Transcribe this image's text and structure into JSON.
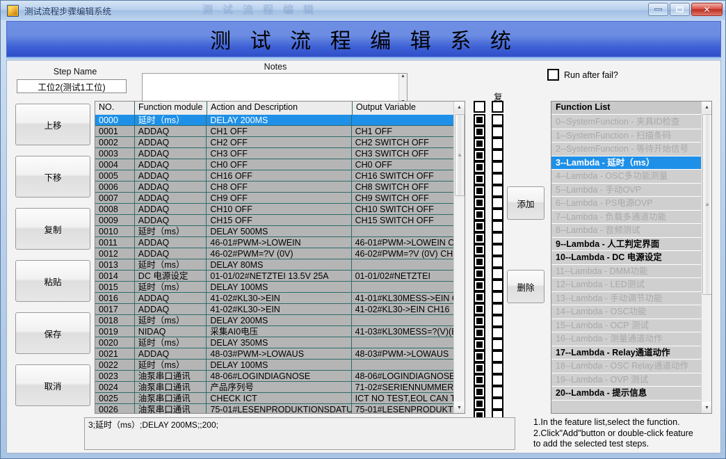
{
  "window": {
    "title": "测试流程步骤编辑系统",
    "ghost_text": "测试流程编辑",
    "minimize": "—",
    "maximize": "□",
    "close": "✕"
  },
  "banner": {
    "title": "测 试 流 程 编 辑 系 统"
  },
  "step": {
    "label": "Step Name",
    "value": "工位2(测试1工位)",
    "placeholder": ""
  },
  "notes": {
    "label": "Notes",
    "value": "",
    "placeholder": ""
  },
  "run_after_fail": {
    "label": "Run after fail?",
    "checked": false
  },
  "left_buttons": [
    {
      "name": "move-up-button",
      "label": "上移"
    },
    {
      "name": "move-down-button",
      "label": "下移"
    },
    {
      "name": "copy-button",
      "label": "复制"
    },
    {
      "name": "paste-button",
      "label": "粘贴"
    },
    {
      "name": "save-button",
      "label": "保存"
    },
    {
      "name": "cancel-button",
      "label": "取消"
    }
  ],
  "middle_buttons": {
    "add": "添加",
    "delete": "删除"
  },
  "checkbox_columns": {
    "header_b": "复",
    "header_a_checked": false,
    "header_b_checked": false,
    "col_a_checked": true,
    "col_b_checked": false,
    "rows": 27
  },
  "grid": {
    "columns": [
      "NO.",
      "Function module",
      "Action and Description",
      "Output Variable"
    ],
    "selected_row": 0,
    "rows": [
      [
        "0000",
        "延时（ms）",
        "DELAY 200MS",
        ""
      ],
      [
        "0001",
        "ADDAQ",
        "CH1 OFF",
        "CH1 OFF"
      ],
      [
        "0002",
        "ADDAQ",
        "CH2 OFF",
        "CH2 SWITCH OFF"
      ],
      [
        "0003",
        "ADDAQ",
        " CH3 OFF",
        "CH3 SWITCH OFF"
      ],
      [
        "0004",
        "ADDAQ",
        "CH0 OFF",
        "CH0 OFF"
      ],
      [
        "0005",
        "ADDAQ",
        "CH16 OFF",
        "CH16 SWITCH OFF"
      ],
      [
        "0006",
        "ADDAQ",
        "CH8 OFF",
        "CH8 SWITCH OFF"
      ],
      [
        "0007",
        "ADDAQ",
        " CH9 OFF",
        "CH9 SWITCH OFF"
      ],
      [
        "0008",
        "ADDAQ",
        "CH10 OFF",
        "CH10 SWITCH OFF"
      ],
      [
        "0009",
        "ADDAQ",
        "CH15 OFF",
        "CH15 SWITCH OFF"
      ],
      [
        "0010",
        "延时（ms）",
        "DELAY 500MS",
        ""
      ],
      [
        "0011",
        "ADDAQ",
        "46-01#PWM->LOWEIN",
        "46-01#PWM->LOWEIN C"
      ],
      [
        "0012",
        "ADDAQ",
        "46-02#PWM=?V (0V)",
        "46-02#PWM=?V (0V) CH"
      ],
      [
        "0013",
        "延时（ms）",
        "DELAY 80MS",
        ""
      ],
      [
        "0014",
        "DC 电源设定",
        "01-01/02#NETZTEI 13.5V 25A",
        "01-01/02#NETZTEI"
      ],
      [
        "0015",
        "延时（ms）",
        "DELAY 100MS",
        ""
      ],
      [
        "0016",
        "ADDAQ",
        "41-02#KL30->EIN",
        "41-01#KL30MESS->EIN C"
      ],
      [
        "0017",
        "ADDAQ",
        "41-02#KL30->EIN",
        "41-02#KL30->EIN CH16"
      ],
      [
        "0018",
        "延时（ms）",
        "DELAY 200MS",
        ""
      ],
      [
        "0019",
        "NIDAQ",
        "采集AI0电压",
        "41-03#KL30MESS=?(V)(E"
      ],
      [
        "0020",
        "延时（ms）",
        "DELAY 350MS",
        ""
      ],
      [
        "0021",
        "ADDAQ",
        "48-03#PWM->LOWAUS",
        "48-03#PWM->LOWAUS"
      ],
      [
        "0022",
        "延时（ms）",
        "DELAY 100MS",
        ""
      ],
      [
        "0023",
        "油泵串口通讯",
        "48-06#LOGINDIAGNOSE",
        "48-06#LOGINDIAGNOSE"
      ],
      [
        "0024",
        "油泵串口通讯",
        "产品序列号",
        "71-02#SERIENNUMMER"
      ],
      [
        "0025",
        "油泵串口通讯",
        "CHECK ICT",
        "ICT NO TEST,EOL CAN T"
      ],
      [
        "0026",
        "油泵串口通讯",
        "75-01#LESENPRODUKTIONSDATU",
        "75-01#LESENPRODUKTI"
      ]
    ]
  },
  "function_list": {
    "header": "Function List",
    "selected_index": 3,
    "items": [
      {
        "label": "0--SystemFunction - 夹具ID检查",
        "state": "dim"
      },
      {
        "label": "1--SystemFunction - 扫描条码",
        "state": "dim"
      },
      {
        "label": "2--SystemFunction - 等待开始信号",
        "state": "dim"
      },
      {
        "label": "3--Lambda - 延时（ms）",
        "state": "selected"
      },
      {
        "label": "4--Lambda - OSC多功能测量",
        "state": "dim"
      },
      {
        "label": "5--Lambda - 手动OVP",
        "state": "dim"
      },
      {
        "label": "6--Lambda - PS电源OVP",
        "state": "dim"
      },
      {
        "label": "7--Lambda - 负载多通道功能",
        "state": "dim"
      },
      {
        "label": "8--Lambda - 音频测试",
        "state": "dim"
      },
      {
        "label": "9--Lambda - 人工判定界面",
        "state": "bold"
      },
      {
        "label": "10--Lambda - DC 电源设定",
        "state": "bold"
      },
      {
        "label": "11--Lambda - DMM功能",
        "state": "dim"
      },
      {
        "label": "12--Lambda - LED测试",
        "state": "dim"
      },
      {
        "label": "13--Lambda - 手动调节功能",
        "state": "dim"
      },
      {
        "label": "14--Lambda - OSC功能",
        "state": "dim"
      },
      {
        "label": "15--Lambda - OCP 测试",
        "state": "dim"
      },
      {
        "label": "16--Lambda - 测量通道动作",
        "state": "dim"
      },
      {
        "label": "17--Lambda - Relay通道动作",
        "state": "bold"
      },
      {
        "label": "18--Lambda - OSC Relay通道动作",
        "state": "dim"
      },
      {
        "label": "19--Lambda - OVP 测试",
        "state": "dim"
      },
      {
        "label": "20--Lambda - 提示信息",
        "state": "bold"
      }
    ]
  },
  "detail_box": {
    "text": "3;延时（ms）;DELAY 200MS;;200;"
  },
  "instructions": {
    "line1": "1.In the feature list,select the function.",
    "line2": "2.Click\"Add\"button or double-click feature",
    "line3": "to add the selected test steps."
  },
  "colors": {
    "banner_blue": "#3f62d6",
    "selection_blue": "#1e90e8",
    "grid_bg": "#b5b5b5",
    "grid_line": "#2f6b6b",
    "list_bg": "#cfcfcf",
    "close_red": "#bc2f23"
  }
}
